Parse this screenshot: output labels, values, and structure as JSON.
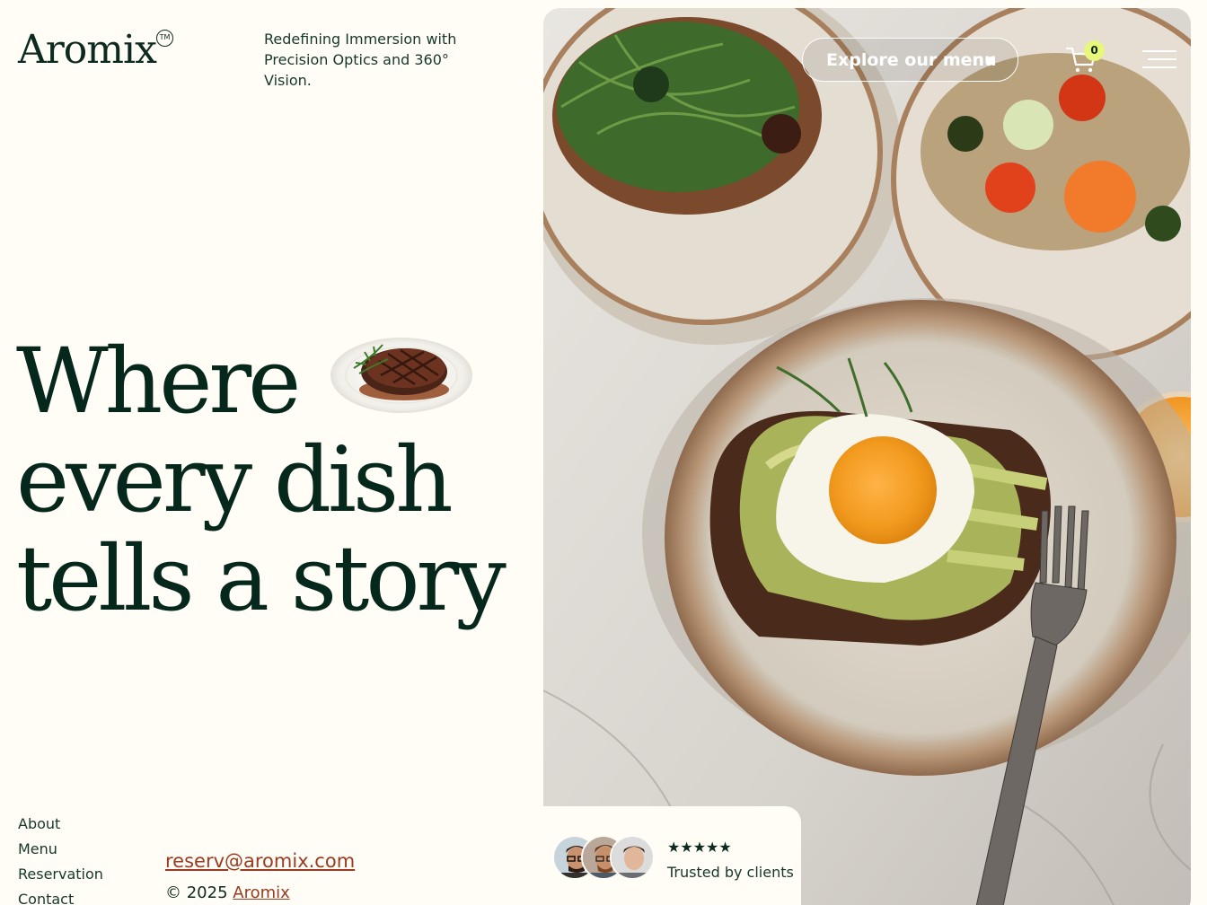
{
  "brand": {
    "logo": "Aromix",
    "trademark": "TM",
    "tagline": "Redefining Immersion with Precision Optics and 360° Vision."
  },
  "hero": {
    "line1": "Where",
    "line2": "every dish",
    "line3": "tells a story"
  },
  "header": {
    "explore_label": "Explore our menu",
    "cart_count": "0"
  },
  "footer_nav": {
    "items": [
      "About",
      "Menu",
      "Reservation",
      "Contact"
    ]
  },
  "contact": {
    "email": "reserv@aromix.com",
    "copyright_prefix": "© 2025",
    "copyright_link": "Aromix"
  },
  "testimonial": {
    "stars": "★★★★★",
    "label": "Trusted by clients"
  },
  "icons": {
    "cart": "cart-icon",
    "menu": "hamburger-menu-icon",
    "steak": "steak-plate-image"
  },
  "colors": {
    "background": "#fffdf5",
    "text": "#06281c",
    "link": "#9a3a22",
    "badge": "#e6f77c"
  }
}
